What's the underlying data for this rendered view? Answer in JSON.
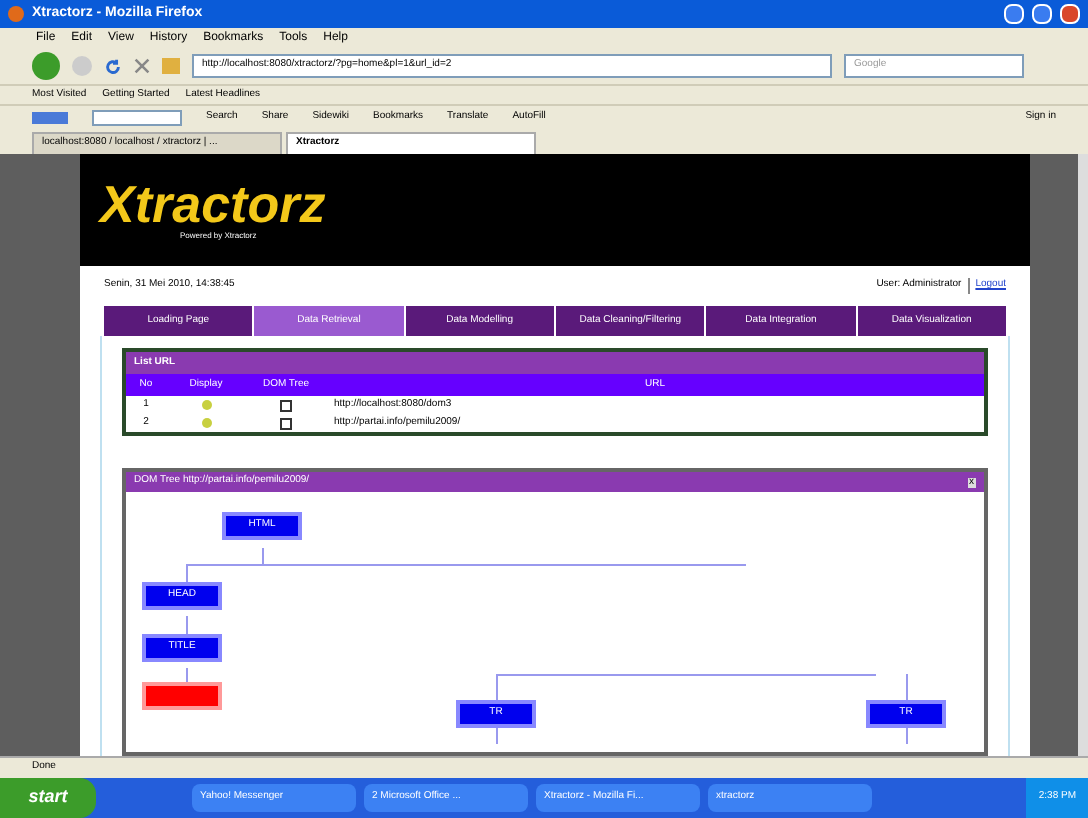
{
  "window": {
    "title": "Xtractorz - Mozilla Firefox"
  },
  "menu": [
    "File",
    "Edit",
    "View",
    "History",
    "Bookmarks",
    "Tools",
    "Help"
  ],
  "address": {
    "value": "http://localhost:8080/xtractorz/?pg=home&pl=1&url_id=2"
  },
  "search": {
    "placeholder": "Google"
  },
  "bookmarks": [
    "Most Visited",
    "Getting Started",
    "Latest Headlines"
  ],
  "google_toolbar": {
    "items": [
      "Search",
      "Share",
      "Sidewiki",
      "Bookmarks",
      "Translate",
      "AutoFill"
    ],
    "sign_in": "Sign in"
  },
  "browser_tabs": [
    {
      "label": "localhost:8080 / localhost / xtractorz | ...",
      "selected": false
    },
    {
      "label": "Xtractorz",
      "selected": true
    }
  ],
  "site": {
    "logo": "Xtractorz",
    "tagline": "Powered by Xtractorz",
    "date": "Senin, 31 Mei 2010, 14:38:45",
    "user": "User: Administrator",
    "logout": "Logout"
  },
  "nav_tabs": [
    {
      "label": "Loading Page",
      "selected": false
    },
    {
      "label": "Data Retrieval",
      "selected": true
    },
    {
      "label": "Data Modelling",
      "selected": false
    },
    {
      "label": "Data Cleaning/Filtering",
      "selected": false
    },
    {
      "label": "Data Integration",
      "selected": false
    },
    {
      "label": "Data Visualization",
      "selected": false
    }
  ],
  "list_url": {
    "title": "List URL",
    "columns": [
      "No",
      "Display",
      "DOM Tree",
      "URL"
    ],
    "rows": [
      {
        "no": "1",
        "url": "http://localhost:8080/dom3"
      },
      {
        "no": "2",
        "url": "http://partai.info/pemilu2009/"
      }
    ]
  },
  "dom_tree": {
    "title": "DOM Tree http://partai.info/pemilu2009/",
    "close": "x",
    "nodes": [
      {
        "label": "HTML",
        "kind": "element"
      },
      {
        "label": "HEAD",
        "kind": "element"
      },
      {
        "label": "TITLE",
        "kind": "element"
      },
      {
        "kind": "selected"
      },
      {
        "label": "TR",
        "kind": "element"
      },
      {
        "label": "TR",
        "kind": "element"
      }
    ]
  },
  "status_bar": "Done",
  "taskbar": {
    "start": "start",
    "tasks": [
      "Yahoo! Messenger",
      "2 Microsoft Office ...",
      "Xtractorz - Mozilla Fi...",
      "xtractorz"
    ],
    "clock": "2:38 PM"
  }
}
